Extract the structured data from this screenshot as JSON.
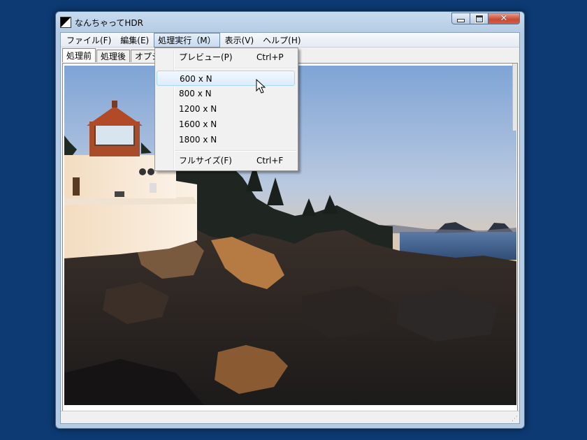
{
  "window": {
    "title": "なんちゃってHDR"
  },
  "menubar": {
    "items": [
      {
        "label": "ファイル(F)"
      },
      {
        "label": "編集(E)"
      },
      {
        "label": "処理実行（M）"
      },
      {
        "label": "表示(V)"
      },
      {
        "label": "ヘルプ(H)"
      }
    ]
  },
  "tabs": [
    {
      "label": "処理前"
    },
    {
      "label": "処理後"
    },
    {
      "label": "オプショ"
    }
  ],
  "dropdown": {
    "preview": {
      "label": "プレビュー(P)",
      "shortcut": "Ctrl+P"
    },
    "sizes": [
      "600 x N",
      "800 x N",
      "1200 x N",
      "1600 x N",
      "1800 x N"
    ],
    "fullsize": {
      "label": "フルサイズ(F)",
      "shortcut": "Ctrl+F"
    }
  },
  "icons": {
    "app": "app-icon",
    "minimize": "minimize-icon",
    "maximize": "maximize-icon",
    "close": "close-icon",
    "cursor": "mouse-cursor-icon"
  },
  "colors": {
    "desktop": "#0d3a73",
    "close_button": "#c94a33",
    "menu_highlight": "#dcecfb"
  }
}
